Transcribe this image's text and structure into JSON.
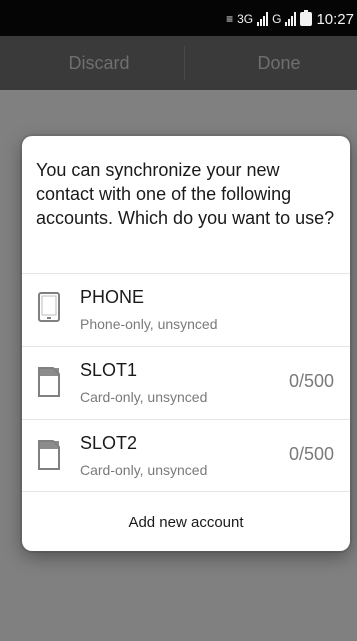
{
  "status_bar": {
    "network": "3G",
    "time": "10:27"
  },
  "action_bar": {
    "discard_label": "Discard",
    "done_label": "Done"
  },
  "dialog": {
    "message": "You can synchronize your new contact with one of the following accounts. Which do you want to use?",
    "accounts": [
      {
        "title": "PHONE",
        "subtitle": "Phone-only, unsynced",
        "count": "",
        "icon": "phone-icon"
      },
      {
        "title": "SLOT1",
        "subtitle": "Card-only, unsynced",
        "count": "0/500",
        "icon": "sim-card-icon"
      },
      {
        "title": "SLOT2",
        "subtitle": "Card-only, unsynced",
        "count": "0/500",
        "icon": "sim-card-icon"
      }
    ],
    "add_account_label": "Add new account"
  }
}
